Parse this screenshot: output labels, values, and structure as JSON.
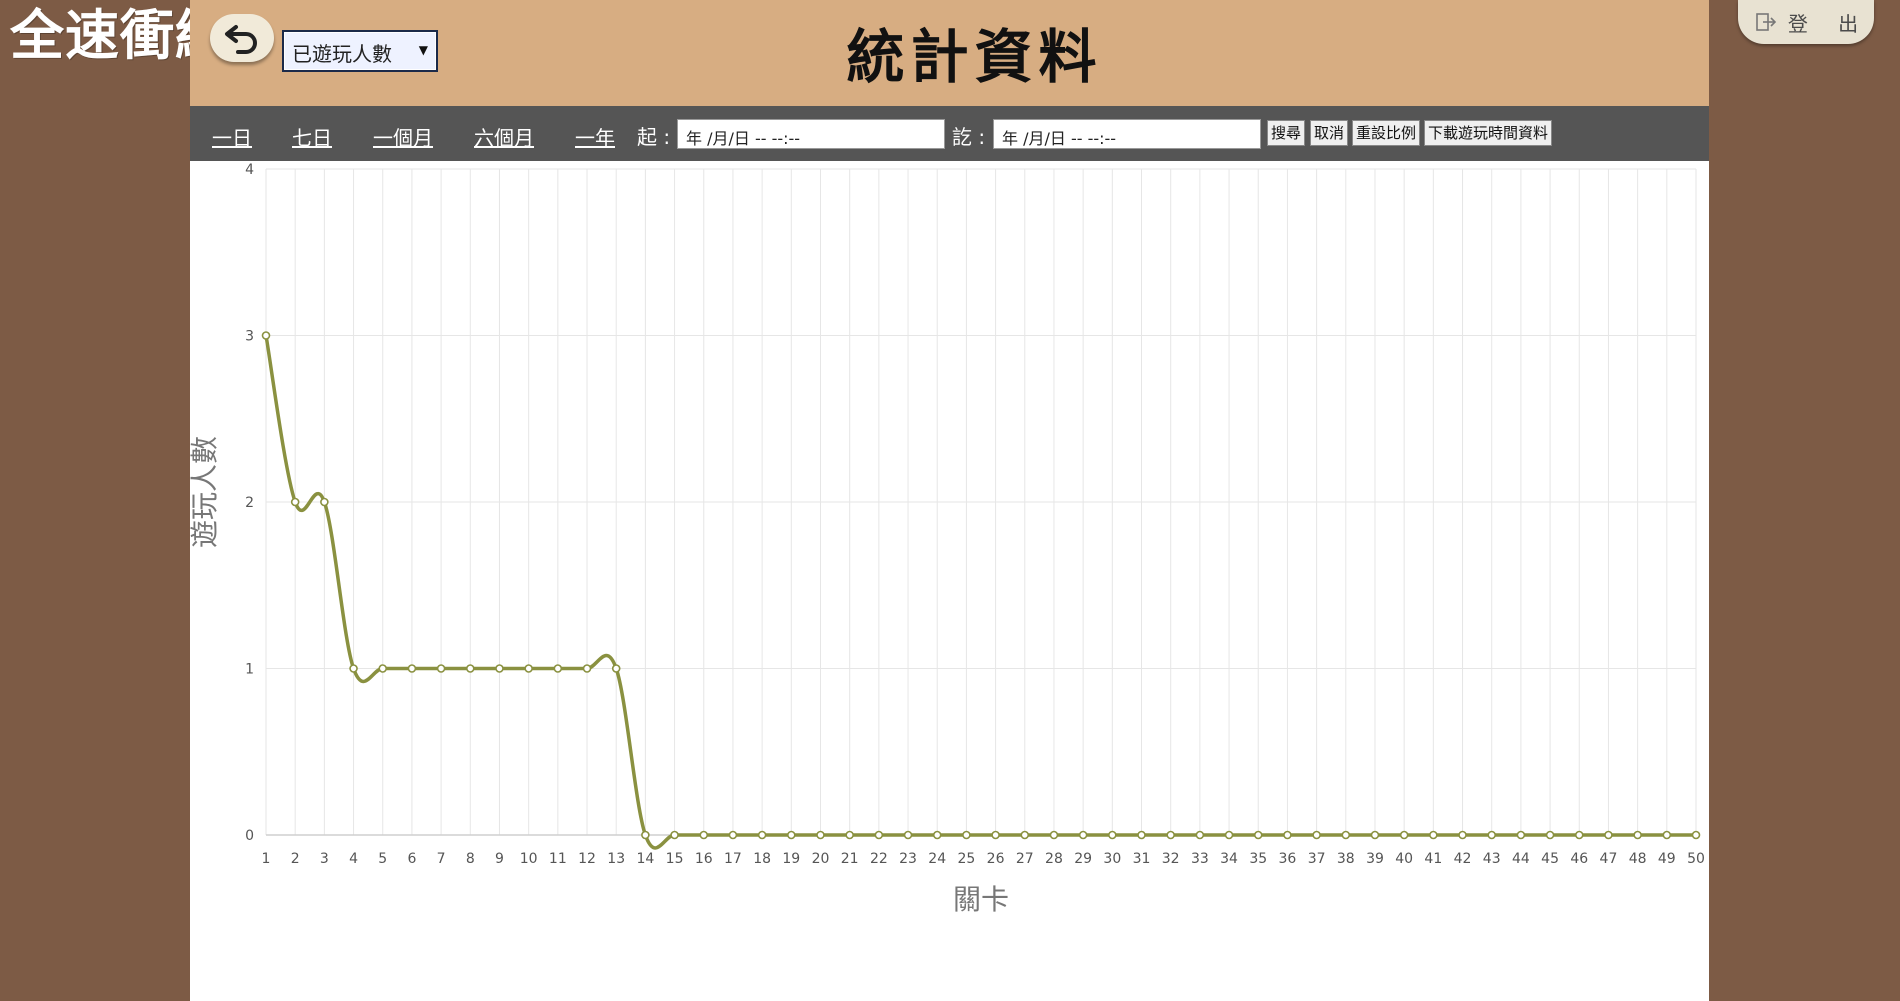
{
  "app": {
    "logo": "全速衝線",
    "logout_label": "登 出",
    "logout_icon": "logout-icon",
    "back_icon": "undo-arrow-icon"
  },
  "header": {
    "title": "統計資料",
    "metric_select": {
      "selected": "已遊玩人數"
    }
  },
  "toolbar": {
    "ranges": [
      "一日",
      "七日",
      "一個月",
      "六個月",
      "一年"
    ],
    "from_label": "起 :",
    "to_label": "訖 :",
    "from_value": "年 /月/日 -- --:--",
    "to_value": "年 /月/日 -- --:--",
    "search_label": "搜尋",
    "cancel_label": "取消",
    "reset_label": "重設比例",
    "download_label": "下載遊玩時間資料"
  },
  "colors": {
    "line": "#8a9140",
    "grid": "#e6e6e6",
    "header_bg": "#d7ad82",
    "toolbar_bg": "#555555",
    "frame_bg": "#7d5b45"
  },
  "chart_data": {
    "type": "line",
    "xlabel": "關卡",
    "ylabel": "遊玩人數",
    "ylim": [
      0,
      4
    ],
    "yticks": [
      0,
      1,
      2,
      3,
      4
    ],
    "grid": true,
    "x": [
      1,
      2,
      3,
      4,
      5,
      6,
      7,
      8,
      9,
      10,
      11,
      12,
      13,
      14,
      15,
      16,
      17,
      18,
      19,
      20,
      21,
      22,
      23,
      24,
      25,
      26,
      27,
      28,
      29,
      30,
      31,
      32,
      33,
      34,
      35,
      36,
      37,
      38,
      39,
      40,
      41,
      42,
      43,
      44,
      45,
      46,
      47,
      48,
      49,
      50
    ],
    "series": [
      {
        "values": [
          3,
          2,
          2,
          1,
          1,
          1,
          1,
          1,
          1,
          1,
          1,
          1,
          1,
          0,
          0,
          0,
          0,
          0,
          0,
          0,
          0,
          0,
          0,
          0,
          0,
          0,
          0,
          0,
          0,
          0,
          0,
          0,
          0,
          0,
          0,
          0,
          0,
          0,
          0,
          0,
          0,
          0,
          0,
          0,
          0,
          0,
          0,
          0,
          0,
          0
        ]
      }
    ]
  }
}
